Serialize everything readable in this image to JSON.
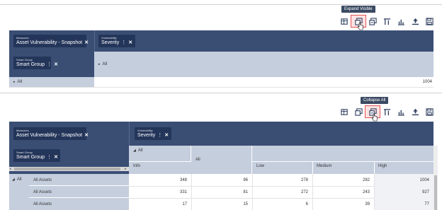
{
  "top": {
    "tooltip": "Expand Visible",
    "toolbar": [
      "table-settings-icon",
      "expand-visible-icon",
      "collapse-all-icon",
      "sort-icon",
      "chart-icon",
      "export-icon",
      "save-icon"
    ],
    "measures_label": "Measures",
    "measures_value": "Asset Vulnerability - Snapshot",
    "vuln_label": "Vulnerability",
    "vuln_value": "Severity",
    "sg_label": "Smart Group",
    "sg_value": "Smart Group",
    "all_col": "All",
    "all_row": "All",
    "total": "1004"
  },
  "bottom": {
    "tooltip": "Collapse All",
    "measures_label": "Measures",
    "measures_value": "Asset Vulnerability - Snapshot",
    "vuln_label": "Vulnerability",
    "vuln_value": "Severity",
    "sg_label": "Smart Group",
    "sg_value": "Smart Group",
    "all_top": "All",
    "all_mid": "All",
    "columns": [
      "Info",
      "Low",
      "Medium",
      "High"
    ],
    "row_all": "All",
    "rows": [
      {
        "label": "All Assets",
        "info": "348",
        "all": "96",
        "low": "278",
        "medium": "282",
        "high": "1004"
      },
      {
        "label": "All Assets",
        "info": "331",
        "all": "81",
        "low": "272",
        "medium": "243",
        "high": "927"
      },
      {
        "label": "All Assets",
        "info": "17",
        "all": "15",
        "low": "6",
        "medium": "39",
        "high": "77"
      }
    ]
  },
  "colors": {
    "header": "#3a4e74",
    "chip": "#24355a",
    "subheader": "#c5cedd",
    "highlight": "#e25555"
  }
}
